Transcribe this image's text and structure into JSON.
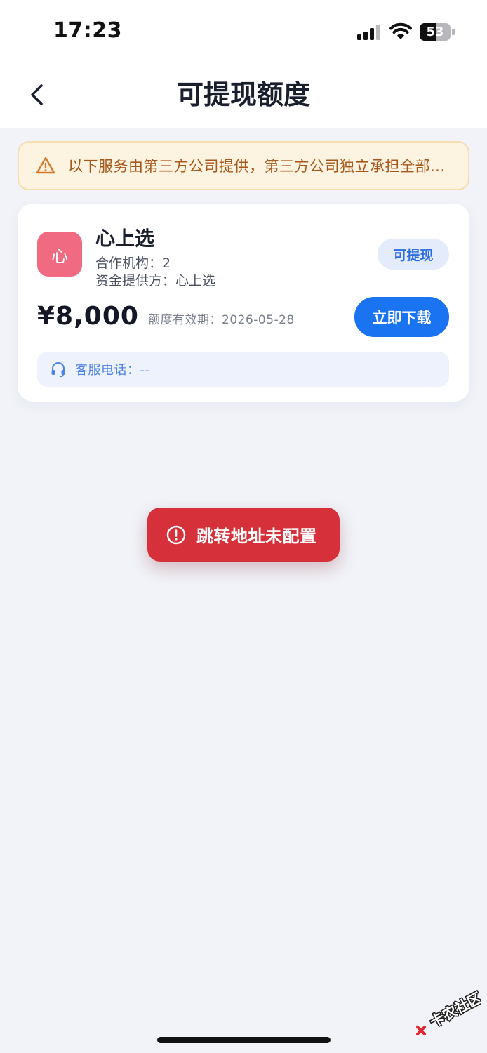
{
  "status_bar": {
    "time": "17:23",
    "battery": "53",
    "battery_level": 0.53
  },
  "nav": {
    "title": "可提现额度"
  },
  "notice": {
    "text": "以下服务由第三方公司提供，第三方公司独立承担全部..."
  },
  "card": {
    "logo_char": "心",
    "name": "心上选",
    "partner": "合作机构：2",
    "funder": "资金提供方：心上选",
    "status": "可提现",
    "amount": "¥8,000",
    "validity": "额度有效期：2026-05-28",
    "download_label": "立即下载",
    "service_phone": "客服电话：--"
  },
  "toast": {
    "text": "跳转地址未配置"
  },
  "watermark": {
    "text": "卡农社区"
  },
  "colors": {
    "primary": "#1a73f0",
    "logo": "#f06b82",
    "toast": "#d6313a",
    "notice_bg": "#fdf3e1",
    "notice_text": "#a8581a"
  }
}
